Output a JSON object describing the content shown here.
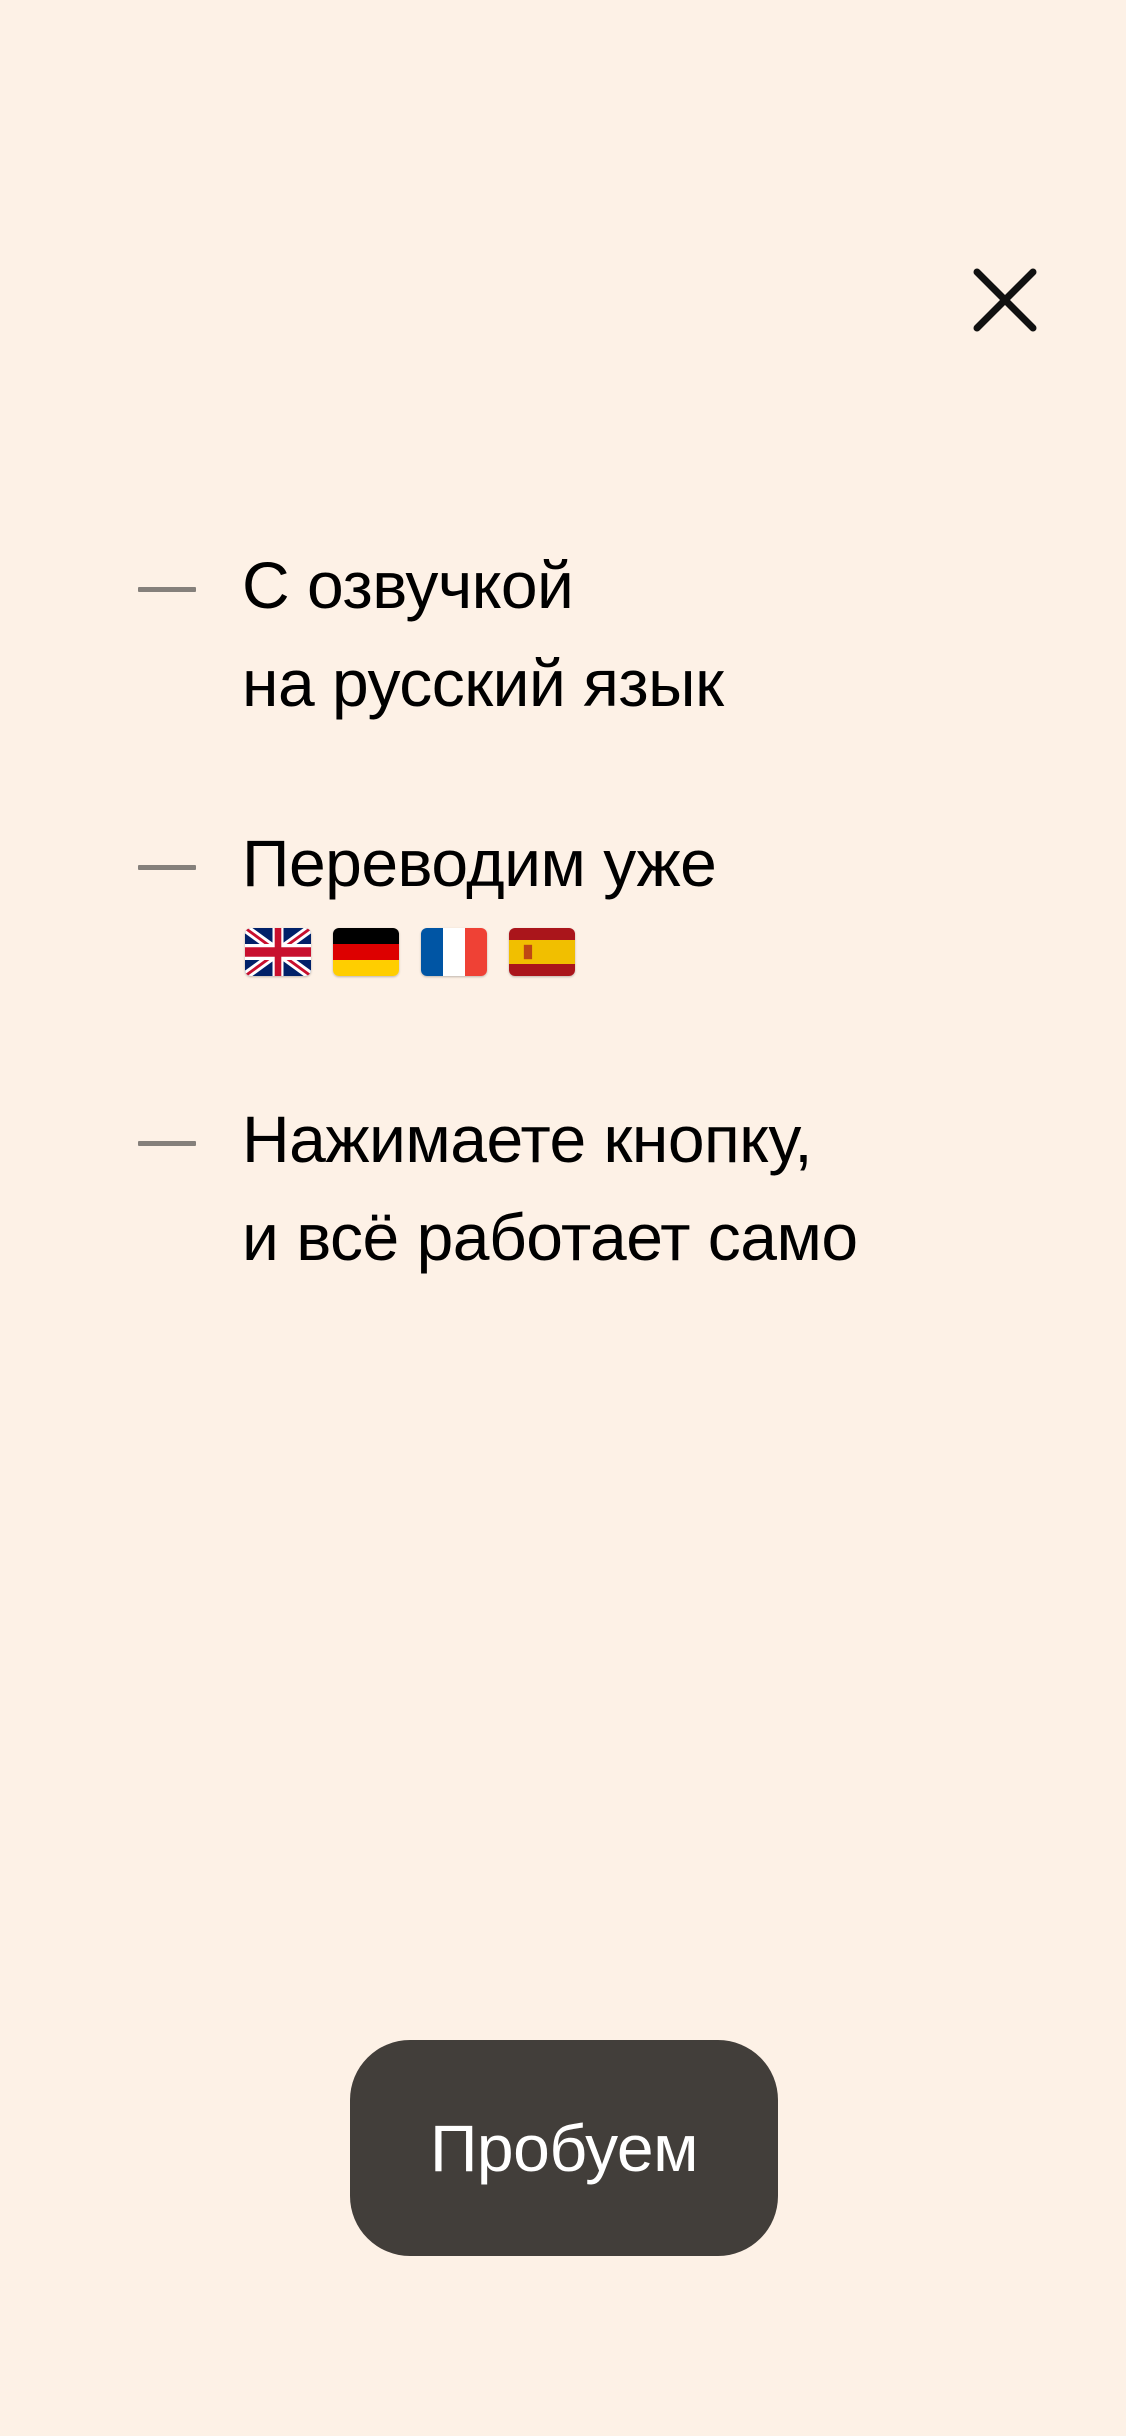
{
  "close_icon": "close-icon",
  "features": [
    {
      "lines": [
        "С озвучкой",
        "на русский язык"
      ]
    },
    {
      "lines": [
        "Переводим уже"
      ],
      "flags": [
        "flag-uk-icon",
        "flag-germany-icon",
        "flag-france-icon",
        "flag-spain-icon"
      ]
    },
    {
      "lines": [
        "Нажимаете кнопку,",
        "и всё работает само"
      ]
    }
  ],
  "cta": {
    "label": "Пробуем"
  },
  "colors": {
    "background": "#fdf1e6",
    "button": "#423e3a",
    "dash": "#85807b",
    "text": "#000000"
  }
}
